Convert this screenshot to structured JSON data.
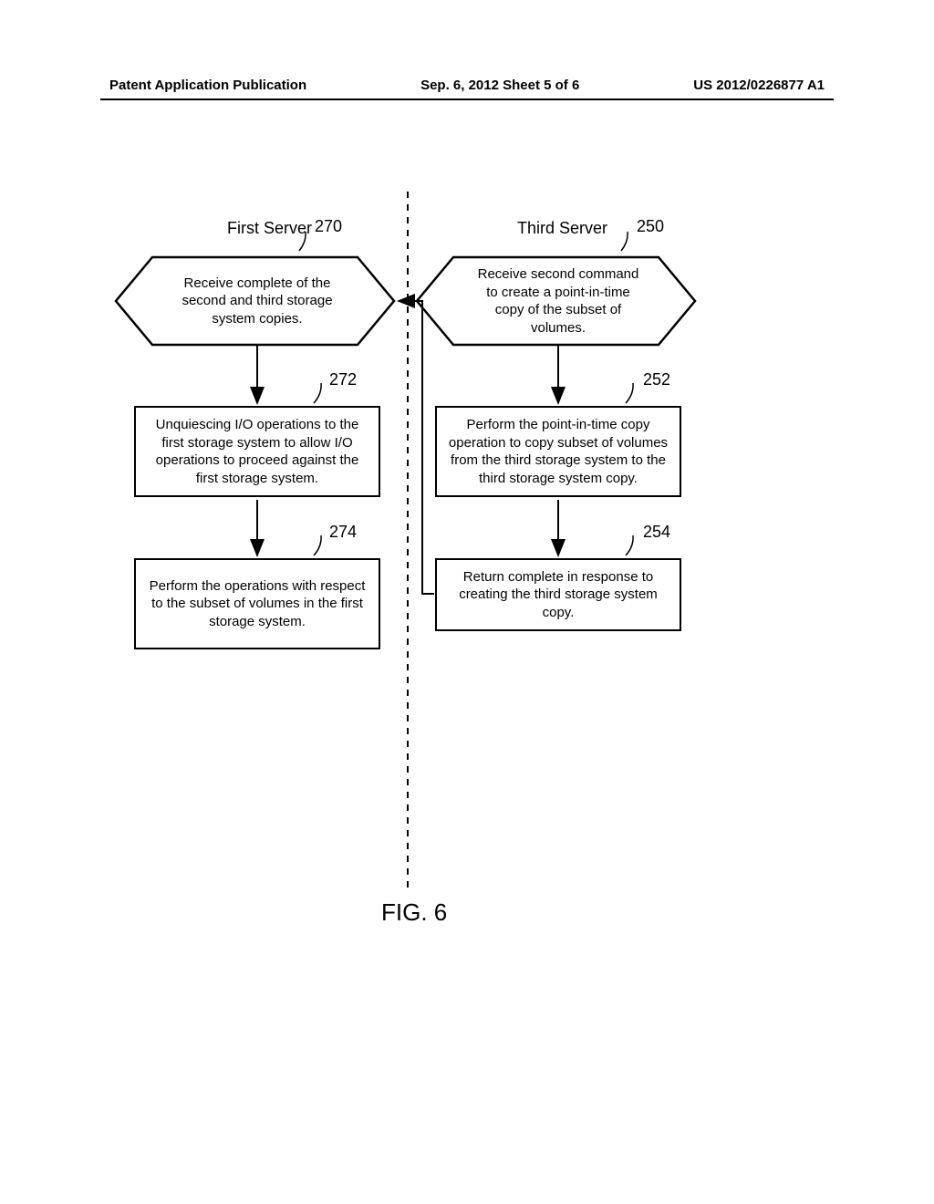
{
  "header": {
    "left": "Patent Application Publication",
    "center": "Sep. 6, 2012   Sheet 5 of 6",
    "right": "US 2012/0226877 A1"
  },
  "diagram": {
    "first_server_title": "First Server",
    "third_server_title": "Third Server",
    "labels": {
      "l270": "270",
      "l250": "250",
      "l272": "272",
      "l252": "252",
      "l274": "274",
      "l254": "254"
    },
    "boxes": {
      "b270": "Receive complete of the second and third storage system copies.",
      "b250": "Receive second command to create a point-in-time copy of the subset of volumes.",
      "b272": "Unquiescing I/O operations to the first storage system to allow I/O operations to proceed against the first storage system.",
      "b252": "Perform the point-in-time copy operation to copy subset of volumes from the third storage system to the third storage system copy.",
      "b274": "Perform the operations with respect to the subset of volumes in the first storage system.",
      "b254": "Return complete in response to creating the third storage system copy."
    },
    "figure": "FIG. 6"
  }
}
